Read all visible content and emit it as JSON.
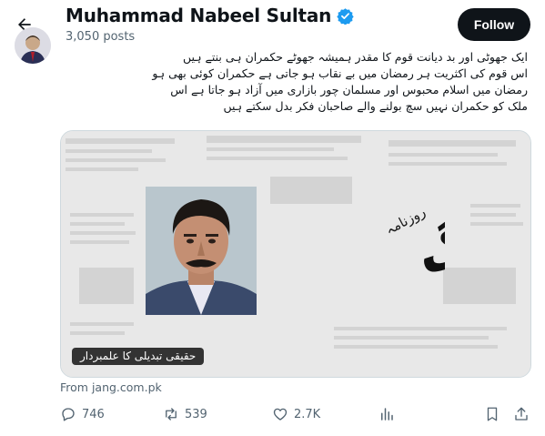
{
  "header": {
    "name": "Muhammad Nabeel Sultan",
    "posts": "3,050 posts",
    "follow_label": "Follow"
  },
  "post": {
    "lines": [
      "ایک جھوٹی اور بد دیانت قوم کا مقدر ہمیشہ جھوٹے حکمران ہی بنتے ہیں",
      "اس قوم کی اکثریت ہر رمضان میں بے نقاب ہو جاتی ہے حکمران کوئی بھی ہو",
      "رمضان میں اسلام محبوس اور مسلمان چور بازاری میں آزاد ہو جاتا ہے اس",
      "ملک کو حکمران نہیں سچ بولنے والے صاحبان فکر بدل سکتے ہیں"
    ]
  },
  "card": {
    "caption": "حقیقی تبدیلی کا علمبردار",
    "logo_main": "جنگ",
    "logo_small": "روزنامہ",
    "source": "From jang.com.pk"
  },
  "actions": {
    "replies": "746",
    "reposts": "539",
    "likes": "2.7K"
  },
  "colors": {
    "text": "#0f1419",
    "muted": "#536471",
    "verified": "#1d9bf0",
    "follow_bg": "#0f1419"
  },
  "icons": [
    "back-arrow-icon",
    "verified-badge-icon",
    "reply-icon",
    "repost-icon",
    "like-icon",
    "views-icon",
    "bookmark-icon",
    "share-icon"
  ]
}
